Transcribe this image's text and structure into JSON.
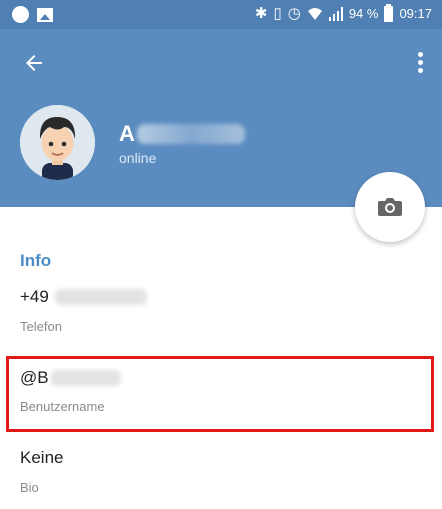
{
  "status_bar": {
    "battery": "94 %",
    "time": "09:17",
    "icons": [
      "circle-notification-icon",
      "image-notification-icon",
      "bluetooth-icon",
      "vibrate-icon",
      "alarm-icon",
      "wifi-icon",
      "signal-icon",
      "battery-icon"
    ]
  },
  "header": {
    "back_icon": "arrow-left-icon",
    "menu_icon": "more-vertical-icon",
    "name_initial": "A",
    "status": "online",
    "camera_icon": "camera-icon"
  },
  "info": {
    "section_title": "Info",
    "phone_prefix": "+49",
    "phone_label": "Telefon",
    "username_prefix": "@B",
    "username_label": "Benutzername",
    "bio_value": "Keine",
    "bio_label": "Bio"
  },
  "colors": {
    "header": "#5b8cc0",
    "status_bar": "#4f7fb3",
    "accent": "#4a8dc6",
    "highlight": "#e01818"
  }
}
